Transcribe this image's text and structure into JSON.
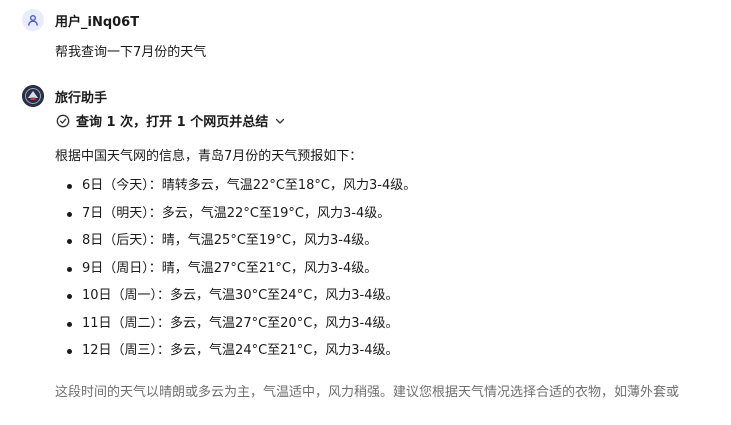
{
  "user": {
    "name": "用户_iNq06T",
    "message": "帮我查询一下7月份的天气"
  },
  "assistant": {
    "name": "旅行助手",
    "search_summary": "查询 1 次，打开 1 个网页并总结",
    "intro": "根据中国天气网的信息，青岛7月份的天气预报如下：",
    "forecast": [
      "6日（今天）：晴转多云，气温22°C至18°C，风力3-4级。",
      "7日（明天）：多云，气温22°C至19°C，风力3-4级。",
      "8日（后天）：晴，气温25°C至19°C，风力3-4级。",
      "9日（周日）：晴，气温27°C至21°C，风力3-4级。",
      "10日（周一）：多云，气温30°C至24°C，风力3-4级。",
      "11日（周二）：多云，气温27°C至20°C，风力3-4级。",
      "12日（周三）：多云，气温24°C至21°C，风力3-4级。"
    ],
    "outro": "这段时间的天气以晴朗或多云为主，气温适中，风力稍强。建议您根据天气情况选择合适的衣物，如薄外套或"
  },
  "icons": {
    "user_avatar": "person-icon",
    "bot_avatar": "travel-assistant-avatar",
    "search_status": "check-circle-icon",
    "expand": "chevron-down-icon"
  },
  "colors": {
    "user_avatar_bg": "#e9ecff",
    "user_avatar_fg": "#4a5bd4",
    "outro_text": "#6f6f6f"
  }
}
